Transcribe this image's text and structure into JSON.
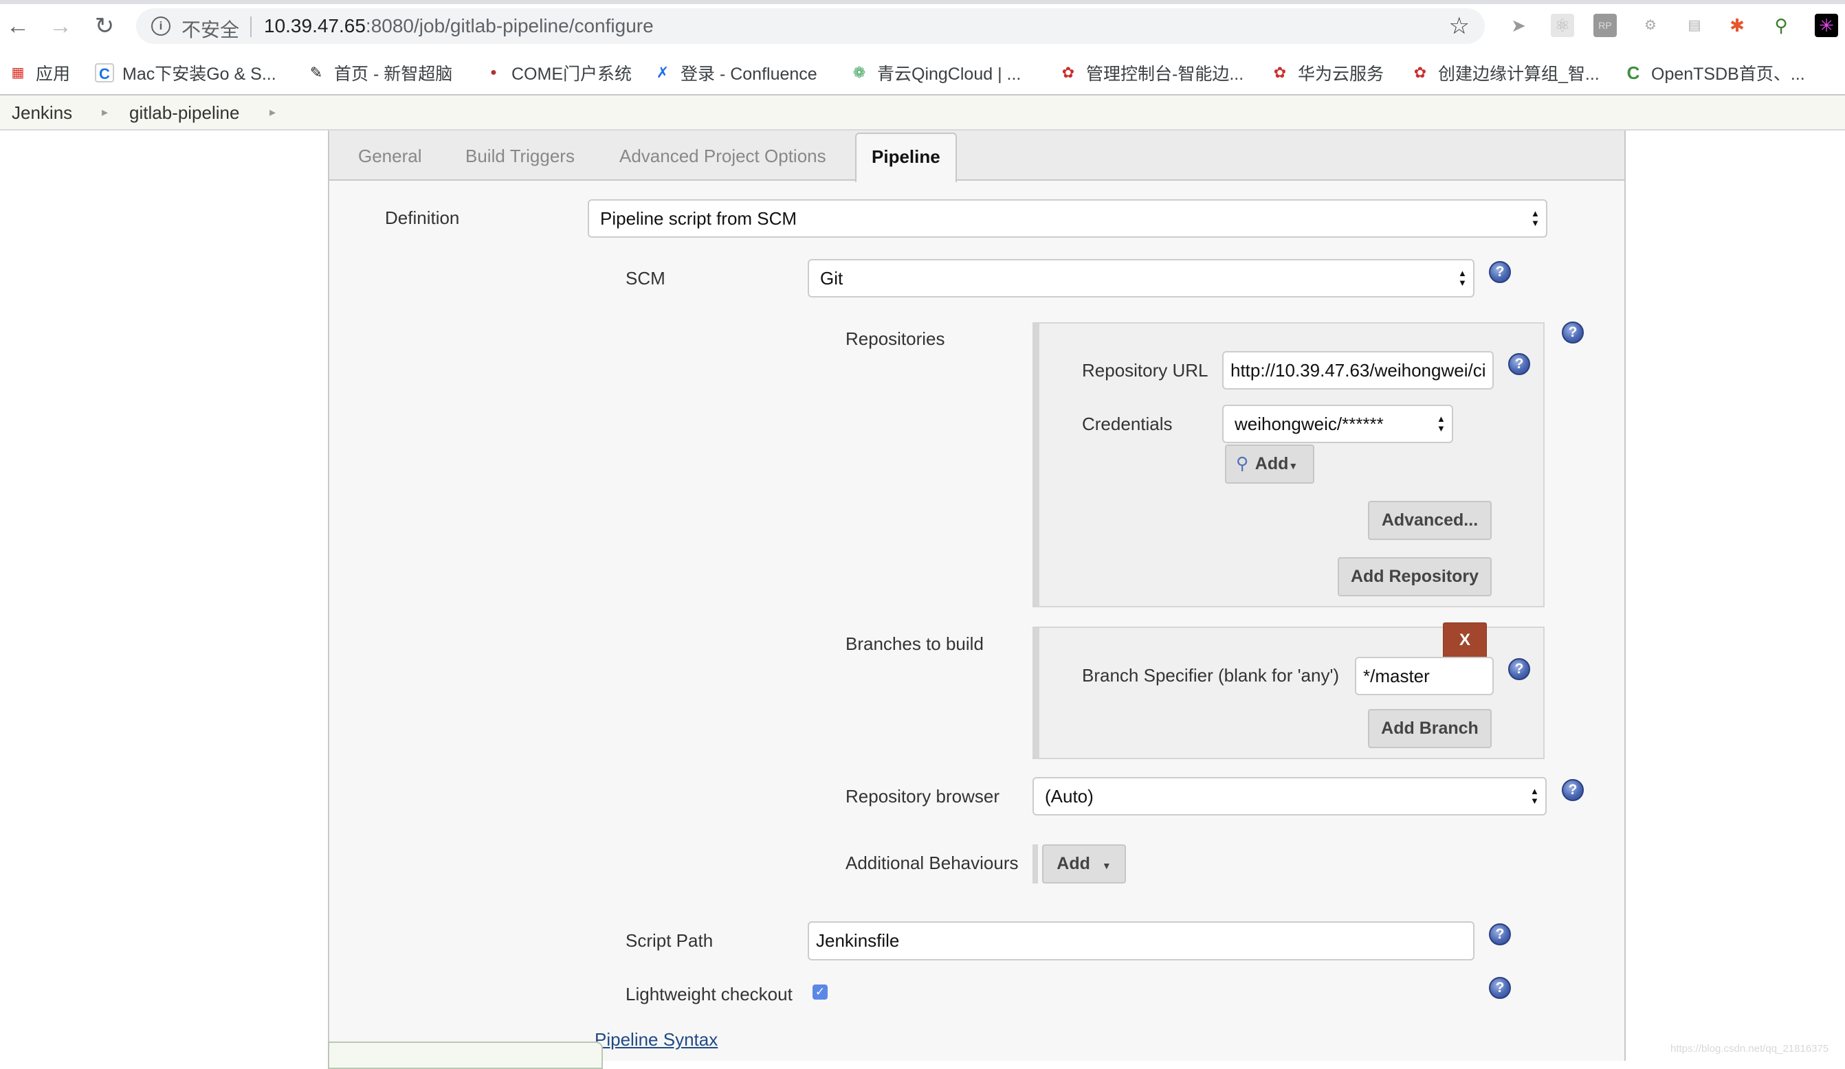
{
  "browser": {
    "insecure_label": "不安全",
    "url_host": "10.39.47.65",
    "url_rest": ":8080/job/gitlab-pipeline/configure",
    "nav": {
      "back": "back-arrow-icon",
      "forward": "forward-arrow-icon",
      "reload": "reload-icon"
    },
    "extensions": [
      "bird-icon",
      "react-icon",
      "rp-icon",
      "sitemap-icon",
      "qr-icon",
      "pinwheel-icon",
      "magnifier-icon",
      "qr-dark-icon"
    ],
    "bookmarks": [
      {
        "label": "应用",
        "icon": "apps-grid-icon"
      },
      {
        "label": "Mac下安装Go & S...",
        "icon": "c-logo-icon"
      },
      {
        "label": "首页 - 新智超脑",
        "icon": "edit-icon"
      },
      {
        "label": "COME门户系统",
        "icon": "portal-icon"
      },
      {
        "label": "登录 - Confluence",
        "icon": "confluence-icon"
      },
      {
        "label": "青云QingCloud | ...",
        "icon": "qingcloud-icon"
      },
      {
        "label": "管理控制台-智能边...",
        "icon": "huawei-icon"
      },
      {
        "label": "华为云服务",
        "icon": "huawei-icon"
      },
      {
        "label": "创建边缘计算组_智...",
        "icon": "huawei-icon"
      },
      {
        "label": "OpenTSDB首页、...",
        "icon": "opentsdb-icon"
      }
    ]
  },
  "breadcrumb": [
    "Jenkins",
    "gitlab-pipeline"
  ],
  "tabs": [
    {
      "label": "General",
      "active": false
    },
    {
      "label": "Build Triggers",
      "active": false
    },
    {
      "label": "Advanced Project Options",
      "active": false
    },
    {
      "label": "Pipeline",
      "active": true
    }
  ],
  "pipeline": {
    "definition_label": "Definition",
    "definition_value": "Pipeline script from SCM",
    "scm_label": "SCM",
    "scm_value": "Git",
    "repositories_label": "Repositories",
    "repo_url_label": "Repository URL",
    "repo_url_value": "http://10.39.47.63/weihongwei/ci",
    "credentials_label": "Credentials",
    "credentials_value": "weihongweic/******",
    "add_credentials_label": "Add",
    "advanced_label": "Advanced...",
    "add_repository_label": "Add Repository",
    "branches_label": "Branches to build",
    "delete_branch_label": "X",
    "branch_spec_label": "Branch Specifier (blank for 'any')",
    "branch_spec_value": "*/master",
    "add_branch_label": "Add Branch",
    "repo_browser_label": "Repository browser",
    "repo_browser_value": "(Auto)",
    "additional_behaviours_label": "Additional Behaviours",
    "additional_add_label": "Add",
    "script_path_label": "Script Path",
    "script_path_value": "Jenkinsfile",
    "lightweight_label": "Lightweight checkout",
    "lightweight_checked": true,
    "pipeline_syntax_link": "Pipeline Syntax"
  },
  "watermark": "https://blog.csdn.net/qq_21816375"
}
